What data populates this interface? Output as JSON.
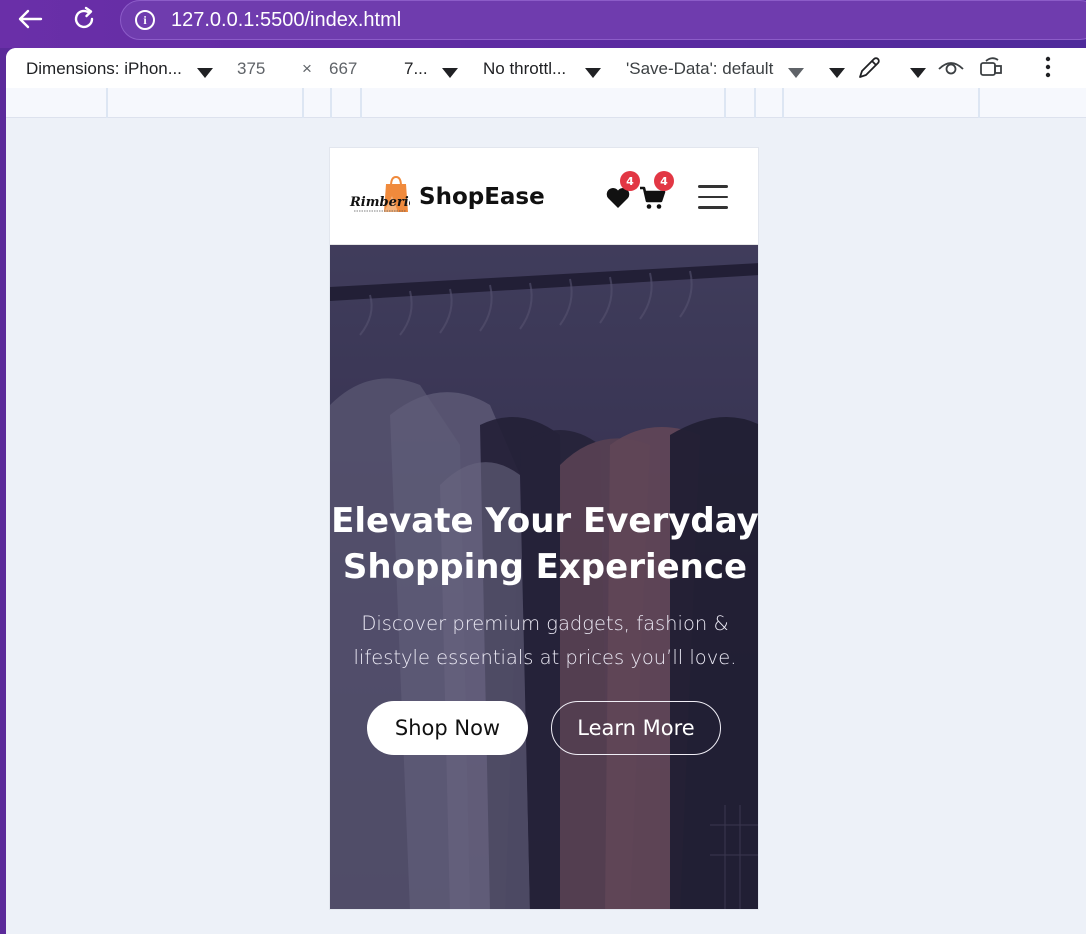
{
  "browser": {
    "url": "127.0.0.1:5500/index.html",
    "info_glyph": "i"
  },
  "devtools": {
    "device_label": "Dimensions: iPhon...",
    "width": "375",
    "times": "×",
    "height": "667",
    "zoom": "7...",
    "throttle": "No throttl...",
    "save_data": "'Save-Data': default"
  },
  "site": {
    "logo_text": "Rimberio",
    "brand": "ShopEase",
    "wishlist_count": "4",
    "cart_count": "4",
    "hero": {
      "title_line1": "Elevate Your Everyday",
      "title_line2": "Shopping Experience",
      "subtitle_line1": "Discover premium gadgets, fashion &",
      "subtitle_line2": "lifestyle essentials at prices you’ll love.",
      "primary_button": "Shop Now",
      "secondary_button": "Learn More"
    }
  },
  "colors": {
    "browser_bar": "#5a2aa0",
    "badge": "#e23744",
    "hero_overlay": "#2c2944",
    "logo_orange": "#f08a3c"
  }
}
